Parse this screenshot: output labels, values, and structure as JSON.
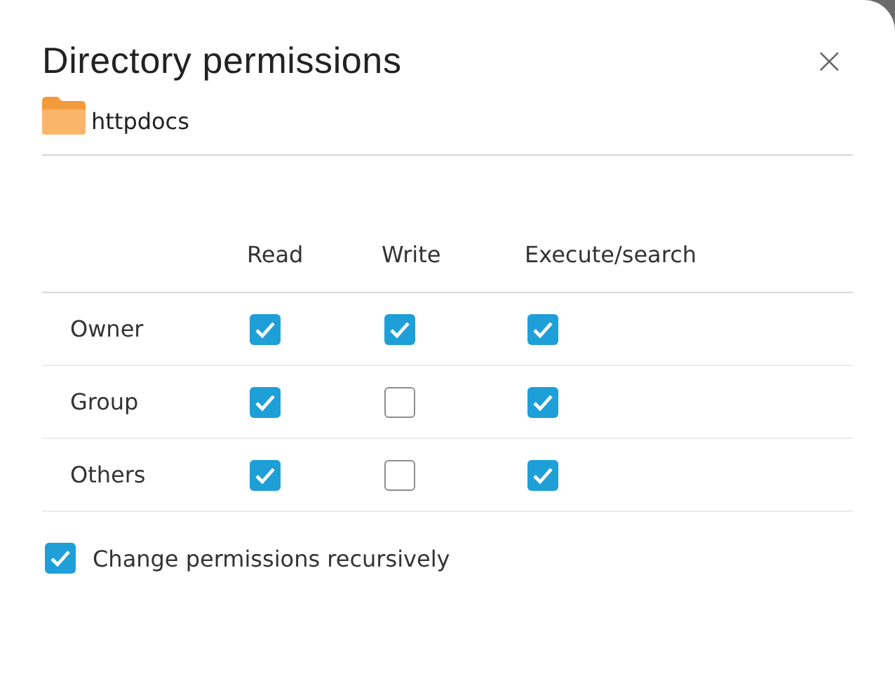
{
  "dialog": {
    "title": "Directory permissions",
    "close": "×"
  },
  "folder": {
    "name": "httpdocs"
  },
  "columns": [
    "Read",
    "Write",
    "Execute/search"
  ],
  "rows": [
    {
      "label": "Owner",
      "permissions": [
        {
          "checked": true
        },
        {
          "checked": true
        },
        {
          "checked": true
        }
      ]
    },
    {
      "label": "Group",
      "permissions": [
        {
          "checked": true
        },
        {
          "checked": false
        },
        {
          "checked": true
        }
      ]
    },
    {
      "label": "Others",
      "permissions": [
        {
          "checked": true
        },
        {
          "checked": false
        },
        {
          "checked": true
        }
      ]
    }
  ],
  "recursive": {
    "label": "Change permissions recursively",
    "checked": true
  }
}
